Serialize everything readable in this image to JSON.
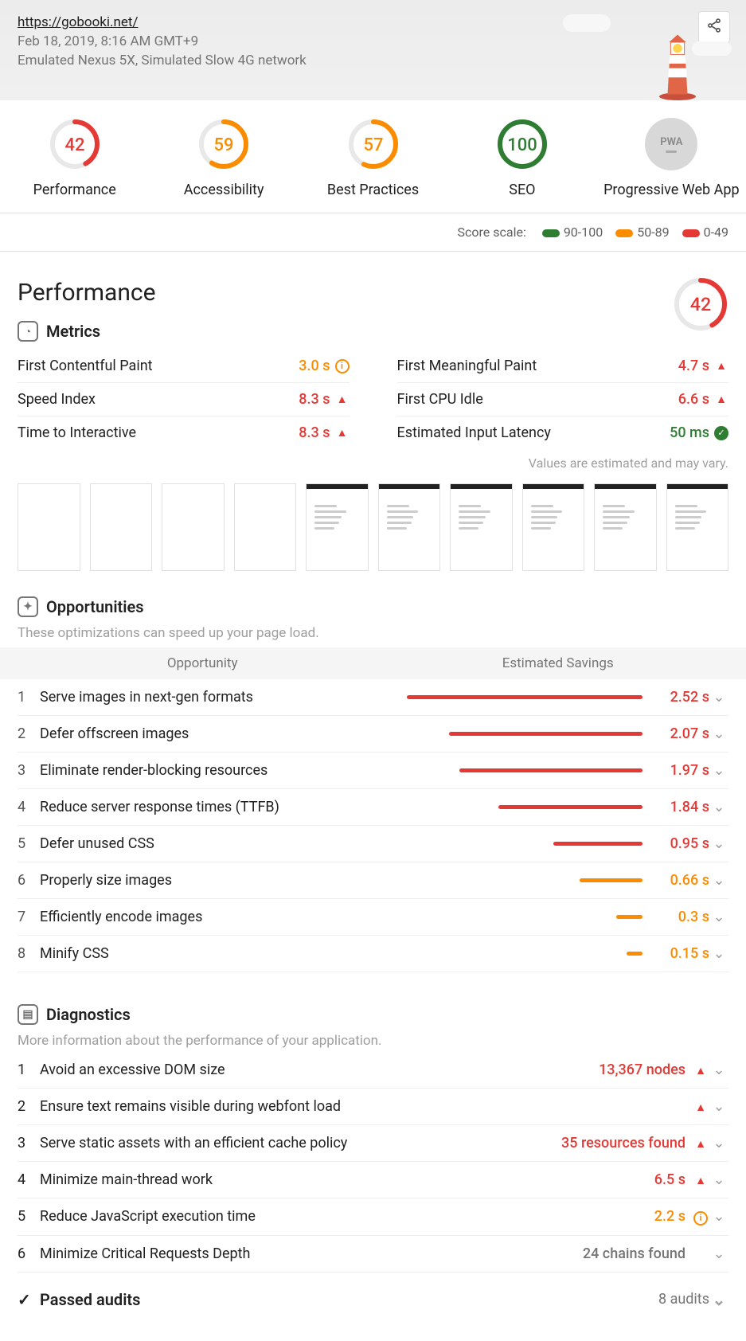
{
  "header": {
    "url": "https://gobooki.net/",
    "timestamp": "Feb 18, 2019, 8:16 AM GMT+9",
    "device": "Emulated Nexus 5X, Simulated Slow 4G network"
  },
  "gauges": [
    {
      "label": "Performance",
      "score": 42,
      "color": "#e53935"
    },
    {
      "label": "Accessibility",
      "score": 59,
      "color": "#fb8c00"
    },
    {
      "label": "Best Practices",
      "score": 57,
      "color": "#fb8c00"
    },
    {
      "label": "SEO",
      "score": 100,
      "color": "#2e7d32"
    },
    {
      "label": "Progressive Web App",
      "score": null,
      "color": "#bdbdbd"
    }
  ],
  "scale": {
    "label": "Score scale:",
    "ranges": [
      {
        "text": "90-100",
        "color": "#2e7d32"
      },
      {
        "text": "50-89",
        "color": "#fb8c00"
      },
      {
        "text": "0-49",
        "color": "#e53935"
      }
    ]
  },
  "performance": {
    "title": "Performance",
    "score": 42,
    "metrics_label": "Metrics",
    "metrics_left": [
      {
        "name": "First Contentful Paint",
        "value": "3.0 s",
        "status": "orange",
        "icon": "info"
      },
      {
        "name": "Speed Index",
        "value": "8.3 s",
        "status": "red",
        "icon": "warn"
      },
      {
        "name": "Time to Interactive",
        "value": "8.3 s",
        "status": "red",
        "icon": "warn"
      }
    ],
    "metrics_right": [
      {
        "name": "First Meaningful Paint",
        "value": "4.7 s",
        "status": "red",
        "icon": "warn"
      },
      {
        "name": "First CPU Idle",
        "value": "6.6 s",
        "status": "red",
        "icon": "warn"
      },
      {
        "name": "Estimated Input Latency",
        "value": "50 ms",
        "status": "green",
        "icon": "check"
      }
    ],
    "note": "Values are estimated and may vary."
  },
  "opportunities": {
    "title": "Opportunities",
    "desc": "These optimizations can speed up your page load.",
    "col1": "Opportunity",
    "col2": "Estimated Savings",
    "items": [
      {
        "name": "Serve images in next-gen formats",
        "value": "2.52 s",
        "pct": 90,
        "status": "red"
      },
      {
        "name": "Defer offscreen images",
        "value": "2.07 s",
        "pct": 74,
        "status": "red"
      },
      {
        "name": "Eliminate render-blocking resources",
        "value": "1.97 s",
        "pct": 70,
        "status": "red"
      },
      {
        "name": "Reduce server response times (TTFB)",
        "value": "1.84 s",
        "pct": 55,
        "status": "red"
      },
      {
        "name": "Defer unused CSS",
        "value": "0.95 s",
        "pct": 34,
        "status": "red"
      },
      {
        "name": "Properly size images",
        "value": "0.66 s",
        "pct": 24,
        "status": "orange"
      },
      {
        "name": "Efficiently encode images",
        "value": "0.3 s",
        "pct": 10,
        "status": "orange"
      },
      {
        "name": "Minify CSS",
        "value": "0.15 s",
        "pct": 6,
        "status": "orange"
      }
    ]
  },
  "diagnostics": {
    "title": "Diagnostics",
    "desc": "More information about the performance of your application.",
    "items": [
      {
        "name": "Avoid an excessive DOM size",
        "value": "13,367 nodes",
        "status": "red",
        "icon": "warn"
      },
      {
        "name": "Ensure text remains visible during webfont load",
        "value": "",
        "status": "red",
        "icon": "warn"
      },
      {
        "name": "Serve static assets with an efficient cache policy",
        "value": "35 resources found",
        "status": "red",
        "icon": "warn"
      },
      {
        "name": "Minimize main-thread work",
        "value": "6.5 s",
        "status": "red",
        "icon": "warn"
      },
      {
        "name": "Reduce JavaScript execution time",
        "value": "2.2 s",
        "status": "orange",
        "icon": "info"
      },
      {
        "name": "Minimize Critical Requests Depth",
        "value": "24 chains found",
        "status": "gray",
        "icon": ""
      }
    ]
  },
  "passed": {
    "title": "Passed audits",
    "count": "8 audits"
  }
}
